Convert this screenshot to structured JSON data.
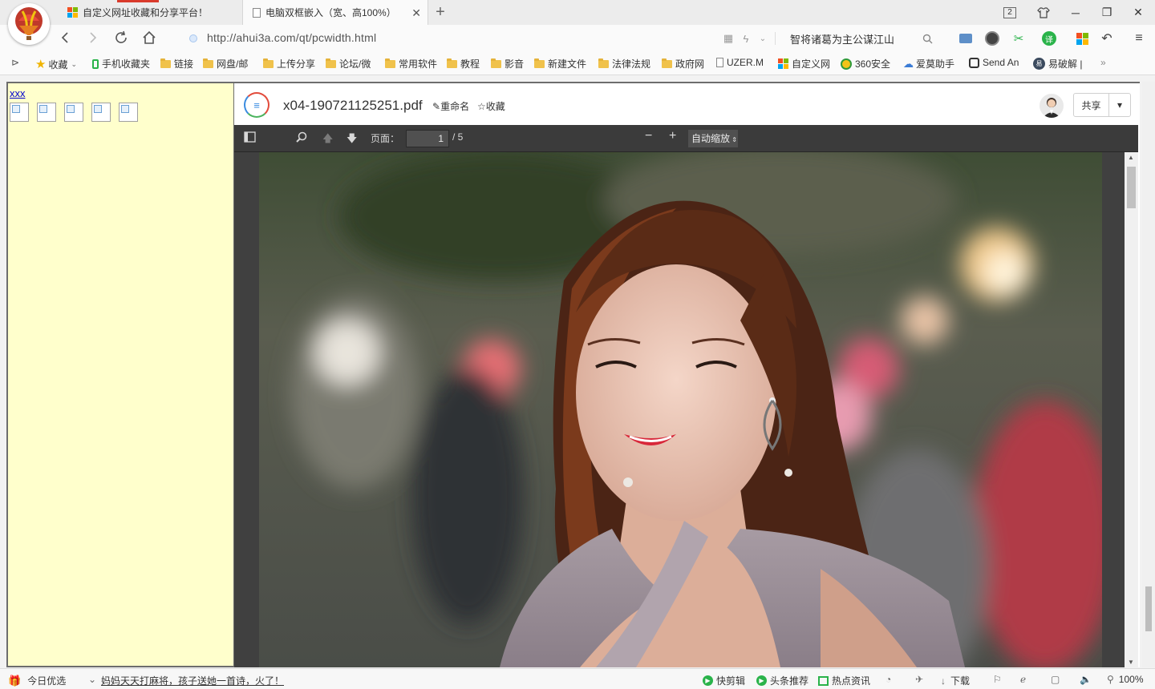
{
  "tabs": [
    {
      "title": "自定义网址收藏和分享平台！",
      "active": false
    },
    {
      "title": "电脑双框嵌入（宽、高100%）",
      "active": true
    }
  ],
  "window": {
    "counter": "2"
  },
  "address_bar": {
    "url": "http://ahui3a.com/qt/pcwidth.html",
    "search_text": "智将诸葛为主公谋江山"
  },
  "bookmarks": [
    {
      "label": "收藏",
      "icon": "star-icon"
    },
    {
      "label": "手机收藏夹",
      "icon": "phone-icon"
    },
    {
      "label": "链接",
      "icon": "folder-icon"
    },
    {
      "label": "网盘/邮",
      "icon": "folder-icon"
    },
    {
      "label": "上传分享",
      "icon": "folder-icon"
    },
    {
      "label": "论坛/微",
      "icon": "folder-icon"
    },
    {
      "label": "常用软件",
      "icon": "folder-icon"
    },
    {
      "label": "教程",
      "icon": "folder-icon"
    },
    {
      "label": "影音",
      "icon": "folder-icon"
    },
    {
      "label": "新建文件",
      "icon": "folder-icon"
    },
    {
      "label": "法律法规",
      "icon": "folder-icon"
    },
    {
      "label": "政府网",
      "icon": "folder-icon"
    },
    {
      "label": "UZER.M",
      "icon": "page-icon"
    },
    {
      "label": "自定义网",
      "icon": "windows-icon"
    },
    {
      "label": "360安全",
      "icon": "360-icon"
    },
    {
      "label": "爱莫助手",
      "icon": "cloud-icon"
    },
    {
      "label": "Send An",
      "icon": "robot-icon"
    },
    {
      "label": "易破解 |",
      "icon": "yi-icon"
    }
  ],
  "bookmarks_more": "»",
  "left_frame": {
    "link_text": "xxx",
    "image_count": 5
  },
  "pdf": {
    "filename": "x04-190721125251.pdf",
    "rename_label": "重命名",
    "favorite_label": "收藏",
    "share_label": "共享",
    "toolbar": {
      "page_label": "页面：",
      "page_value": "1",
      "page_total": "/ 5",
      "zoom_label": "自动缩放"
    }
  },
  "statusbar": {
    "today_label": "今日优选",
    "headline": "妈妈天天打麻将，孩子送她一首诗，火了！",
    "items": [
      "快剪辑",
      "头条推荐",
      "热点资讯",
      "下载"
    ],
    "zoom": "100%"
  }
}
